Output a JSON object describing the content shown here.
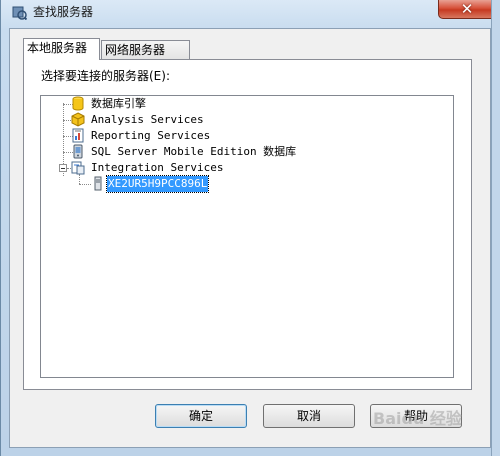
{
  "window": {
    "title": "查找服务器",
    "close_label": "✕"
  },
  "tabs": [
    {
      "label": "本地服务器",
      "active": true
    },
    {
      "label": "网络服务器",
      "active": false
    }
  ],
  "prompt": "选择要连接的服务器(E):",
  "tree": {
    "items": [
      {
        "label": "数据库引擎",
        "icon": "database-engine-icon"
      },
      {
        "label": "Analysis Services",
        "icon": "analysis-services-icon"
      },
      {
        "label": "Reporting Services",
        "icon": "reporting-services-icon"
      },
      {
        "label": "SQL Server Mobile Edition 数据库",
        "icon": "mobile-database-icon"
      },
      {
        "label": "Integration Services",
        "icon": "integration-services-icon",
        "expanded": true,
        "children": [
          {
            "label": "XE2UR5H9PCC896L",
            "icon": "server-icon",
            "selected": true
          }
        ]
      }
    ]
  },
  "buttons": {
    "ok": "确定",
    "cancel": "取消",
    "help": "帮助"
  },
  "watermark": "Baidu 经验",
  "colors": {
    "selection": "#3399ff",
    "close_button": "#c63a22"
  }
}
